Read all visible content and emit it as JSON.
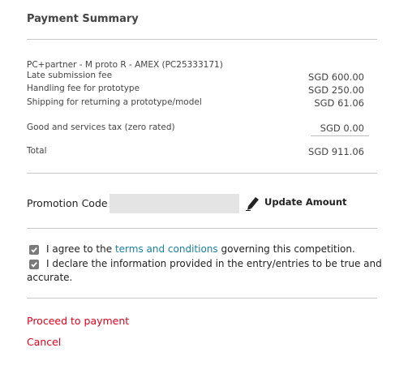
{
  "header": {
    "title": "Payment Summary"
  },
  "summary": {
    "item_title": "PC+partner - M proto R - AMEX (PC25333171)",
    "lines": [
      {
        "label": "Late submission fee",
        "amount": "SGD 600.00"
      },
      {
        "label": "Handling fee for prototype",
        "amount": "SGD 250.00"
      },
      {
        "label": "Shipping for returning a prototype/model",
        "amount": "SGD 61.06"
      }
    ],
    "gst_label": "Good and services tax (zero rated)",
    "gst_amount": "SGD 0.00",
    "total_label": "Total",
    "total_amount": "SGD 911.06"
  },
  "promo": {
    "label": "Promotion Code :",
    "value": "",
    "update_label": "Update Amount",
    "icon": "pencil-icon"
  },
  "agreements": {
    "agree_prefix": "I agree to the ",
    "agree_link": "terms and conditions",
    "agree_suffix": " governing this competition.",
    "agree_checked": true,
    "declare_line1": "I declare the information provided in the entry/entries to be true and",
    "declare_line2": "accurate.",
    "declare_checked": true
  },
  "actions": {
    "proceed_label": "Proceed to payment",
    "cancel_label": "Cancel"
  },
  "colors": {
    "accent_red": "#e0001b",
    "link_teal": "#1a7fa0",
    "input_bg": "#e4e4e4",
    "checkbox_bg": "#7a7a7a"
  }
}
